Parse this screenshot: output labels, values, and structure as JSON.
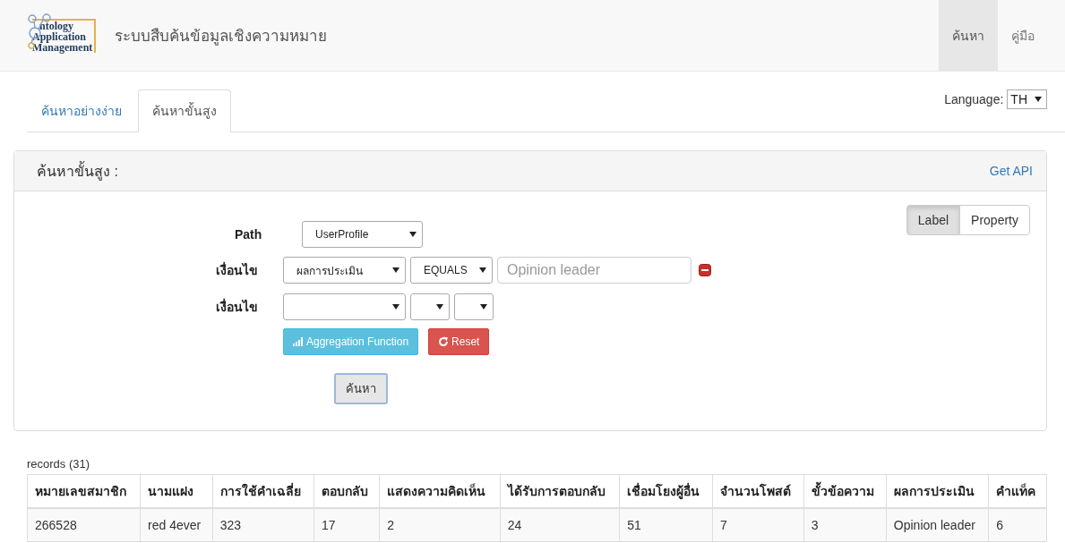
{
  "header": {
    "logo_lines": [
      "ntology",
      "Application",
      "Management"
    ],
    "title": "ระบบสืบค้นข้อมูลเชิงความหมาย",
    "nav": [
      {
        "label": "ค้นหา",
        "selected": true
      },
      {
        "label": "คู่มือ",
        "selected": false
      }
    ]
  },
  "tabs": [
    {
      "label": "ค้นหาอย่างง่าย",
      "selected": false
    },
    {
      "label": "ค้นหาขั้นสูง",
      "selected": true
    }
  ],
  "language": {
    "label": "Language:",
    "value": "TH"
  },
  "panel": {
    "title": "ค้นหาขั้นสูง :",
    "api_link": "Get API",
    "view_toggle": [
      {
        "label": "Label",
        "selected": true
      },
      {
        "label": "Property",
        "selected": false
      }
    ],
    "path": {
      "label": "Path",
      "value": "UserProfile"
    },
    "conditions": [
      {
        "label": "เงื่อนไข",
        "field": "ผลการประเมิน",
        "operator": "EQUALS",
        "placeholder": "Opinion leader",
        "removable": true
      },
      {
        "label": "เงื่อนไข",
        "removable": false
      }
    ],
    "buttons": [
      {
        "label": "Aggregation Function",
        "kind": "aggregate"
      },
      {
        "label": "Reset",
        "kind": "reset"
      }
    ],
    "search_button": "ค้นหา"
  },
  "results": {
    "count": "records (31)",
    "columns": [
      "หมายเลขสมาชิก",
      "นามแฝง",
      "การใช้คำเฉลี่ย",
      "ตอบกลับ",
      "แสดงความคิดเห็น",
      "ได้รับการตอบกลับ",
      "เชื่อมโยงผู้อื่น",
      "จำนวนโพสต์",
      "ขั้วข้อความ",
      "ผลการประเมิน",
      "คำแท็ค"
    ],
    "rows": [
      [
        "266528",
        "red 4ever",
        "323",
        "17",
        "2",
        "24",
        "51",
        "7",
        "3",
        "Opinion leader",
        "6"
      ]
    ]
  }
}
